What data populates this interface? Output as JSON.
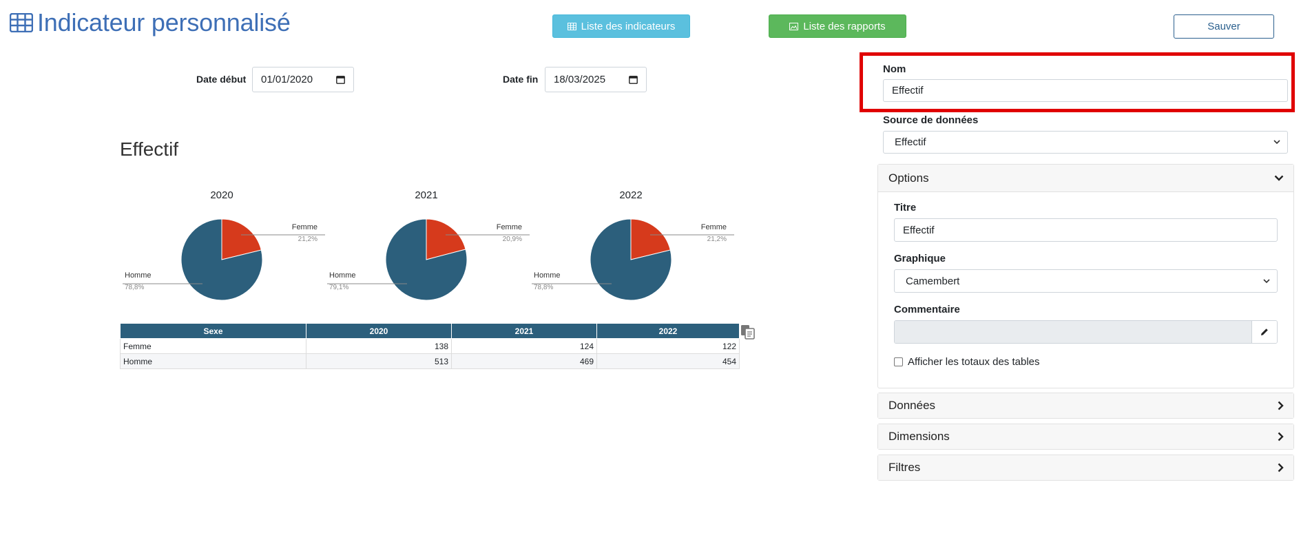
{
  "header": {
    "title": "Indicateur personnalisé",
    "btn_indicators": "Liste des indicateurs",
    "btn_reports": "Liste des rapports",
    "btn_save": "Sauver",
    "icons": [
      "table-icon",
      "picture-icon"
    ]
  },
  "filters": {
    "start_label": "Date début",
    "start_value": "01/01/2020",
    "end_label": "Date fin",
    "end_value": "18/03/2025"
  },
  "chart": {
    "heading": "Effectif"
  },
  "chart_data": [
    {
      "type": "pie",
      "title": "2020",
      "categories": [
        "Femme",
        "Homme"
      ],
      "values": [
        21.2,
        78.8
      ],
      "value_labels": [
        "21,2%",
        "78,8%"
      ],
      "colors": [
        "#d63a1c",
        "#2c5f7c"
      ]
    },
    {
      "type": "pie",
      "title": "2021",
      "categories": [
        "Femme",
        "Homme"
      ],
      "values": [
        20.9,
        79.1
      ],
      "value_labels": [
        "20,9%",
        "79,1%"
      ],
      "colors": [
        "#d63a1c",
        "#2c5f7c"
      ]
    },
    {
      "type": "pie",
      "title": "2022",
      "categories": [
        "Femme",
        "Homme"
      ],
      "values": [
        21.2,
        78.8
      ],
      "value_labels": [
        "21,2%",
        "78,8%"
      ],
      "colors": [
        "#d63a1c",
        "#2c5f7c"
      ]
    }
  ],
  "table": {
    "headers": [
      "Sexe",
      "2020",
      "2021",
      "2022"
    ],
    "rows": [
      [
        "Femme",
        "138",
        "124",
        "122"
      ],
      [
        "Homme",
        "513",
        "469",
        "454"
      ]
    ]
  },
  "form": {
    "name_label": "Nom",
    "name_value": "Effectif",
    "source_label": "Source de données",
    "source_value": "Effectif",
    "options_title": "Options",
    "titre_label": "Titre",
    "titre_value": "Effectif",
    "graph_label": "Graphique",
    "graph_value": "Camembert",
    "comment_label": "Commentaire",
    "totals_label": "Afficher les totaux des tables",
    "panels": [
      "Données",
      "Dimensions",
      "Filtres"
    ]
  },
  "colors": {
    "accent": "#3e6fb6",
    "info": "#5bc0de",
    "success": "#5cb85c",
    "femme": "#d63a1c",
    "homme": "#2c5f7c",
    "highlight": "#e00000"
  }
}
